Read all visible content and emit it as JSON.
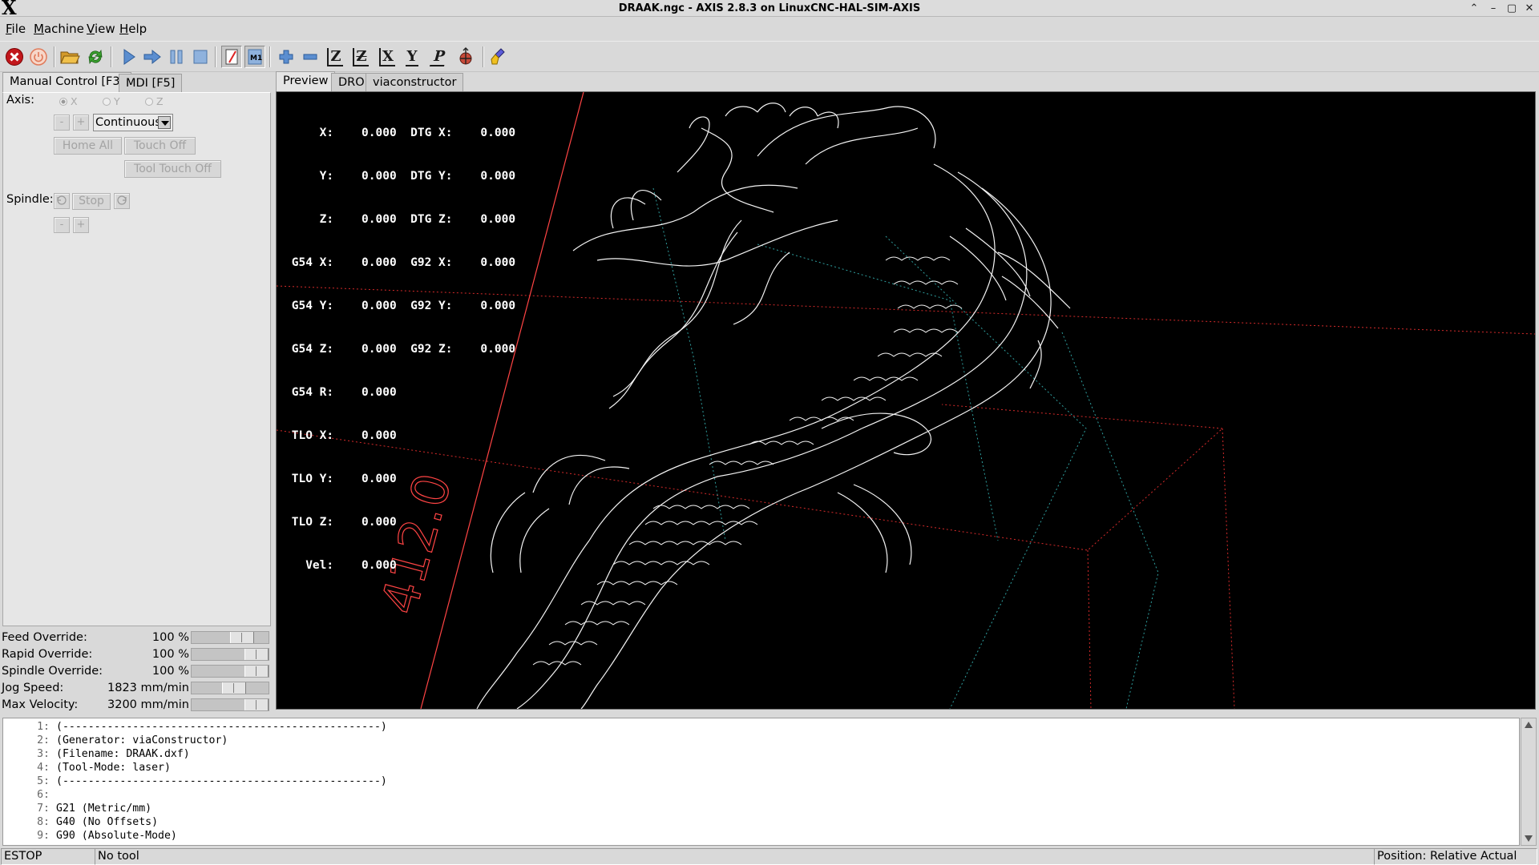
{
  "window": {
    "title": "DRAAK.ngc - AXIS 2.8.3 on LinuxCNC-HAL-SIM-AXIS",
    "logo": "X",
    "controls": [
      "⌃",
      "–",
      "▢",
      "✕"
    ]
  },
  "menubar": {
    "items": [
      {
        "label": "File",
        "underline": "F"
      },
      {
        "label": "Machine",
        "underline": "M"
      },
      {
        "label": "View",
        "underline": "V"
      },
      {
        "label": "Help",
        "underline": "H"
      }
    ]
  },
  "toolbar": {
    "icons": [
      "estop-icon",
      "machine-power-icon",
      "open-file-icon",
      "reload-icon",
      "run-icon",
      "step-icon",
      "pause-icon",
      "stop-icon",
      "block-delete-icon",
      "optional-stop-icon",
      "zoom-in-icon",
      "zoom-out-icon",
      "view-z-icon",
      "view-z2-icon",
      "view-x-icon",
      "view-y-icon",
      "view-p-icon",
      "rotate-view-icon",
      "clear-plot-icon"
    ],
    "letters": {
      "z": "Z",
      "z2": "Z",
      "x": "X",
      "y": "Y",
      "p": "P"
    }
  },
  "left_tabs": [
    "Manual Control [F3]",
    "MDI [F5]"
  ],
  "manual": {
    "axis_label": "Axis:",
    "axes": [
      "X",
      "Y",
      "Z"
    ],
    "selected_axis": "X",
    "jog_minus": "-",
    "jog_plus": "+",
    "jog_mode": "Continuous",
    "home_all": "Home All",
    "touch_off": "Touch Off",
    "tool_touch_off": "Tool Touch Off",
    "spindle_label": "Spindle:",
    "spindle_stop": "Stop",
    "spindle_minus": "-",
    "spindle_plus": "+"
  },
  "overrides": [
    {
      "label": "Feed Override:",
      "value": "100 %",
      "fraction": 0.72
    },
    {
      "label": "Rapid Override:",
      "value": "100 %",
      "fraction": 1.0
    },
    {
      "label": "Spindle Override:",
      "value": "100 %",
      "fraction": 1.0
    },
    {
      "label": "Jog Speed:",
      "value": "1823 mm/min",
      "fraction": 0.57
    },
    {
      "label": "Max Velocity:",
      "value": "3200 mm/min",
      "fraction": 1.0
    }
  ],
  "preview_tabs": [
    "Preview",
    "DRO",
    "viaconstructor"
  ],
  "dro": {
    "lines": [
      "     X:    0.000  DTG X:    0.000",
      "     Y:    0.000  DTG Y:    0.000",
      "     Z:    0.000  DTG Z:    0.000",
      " G54 X:    0.000  G92 X:    0.000",
      " G54 Y:    0.000  G92 Y:    0.000",
      " G54 Z:    0.000  G92 Z:    0.000",
      " G54 R:    0.000",
      " TLO X:    0.000",
      " TLO Y:    0.000",
      " TLO Z:    0.000",
      "   Vel:    0.000"
    ]
  },
  "dimension_label": "412.0",
  "colors": {
    "preview_bg": "#000000",
    "toolpath": "#ffffff",
    "extents": "#ff3b3b",
    "rapid": "#1f8f8f"
  },
  "gcode": [
    {
      "n": "1:",
      "text": "(--------------------------------------------------)"
    },
    {
      "n": "2:",
      "text": "(Generator: viaConstructor)"
    },
    {
      "n": "3:",
      "text": "(Filename: DRAAK.dxf)"
    },
    {
      "n": "4:",
      "text": "(Tool-Mode: laser)"
    },
    {
      "n": "5:",
      "text": "(--------------------------------------------------)"
    },
    {
      "n": "6:",
      "text": ""
    },
    {
      "n": "7:",
      "text": "G21 (Metric/mm)"
    },
    {
      "n": "8:",
      "text": "G40 (No Offsets)"
    },
    {
      "n": "9:",
      "text": "G90 (Absolute-Mode)"
    }
  ],
  "status": {
    "estop": "ESTOP",
    "tool": "No tool",
    "position": "Position: Relative Actual"
  }
}
